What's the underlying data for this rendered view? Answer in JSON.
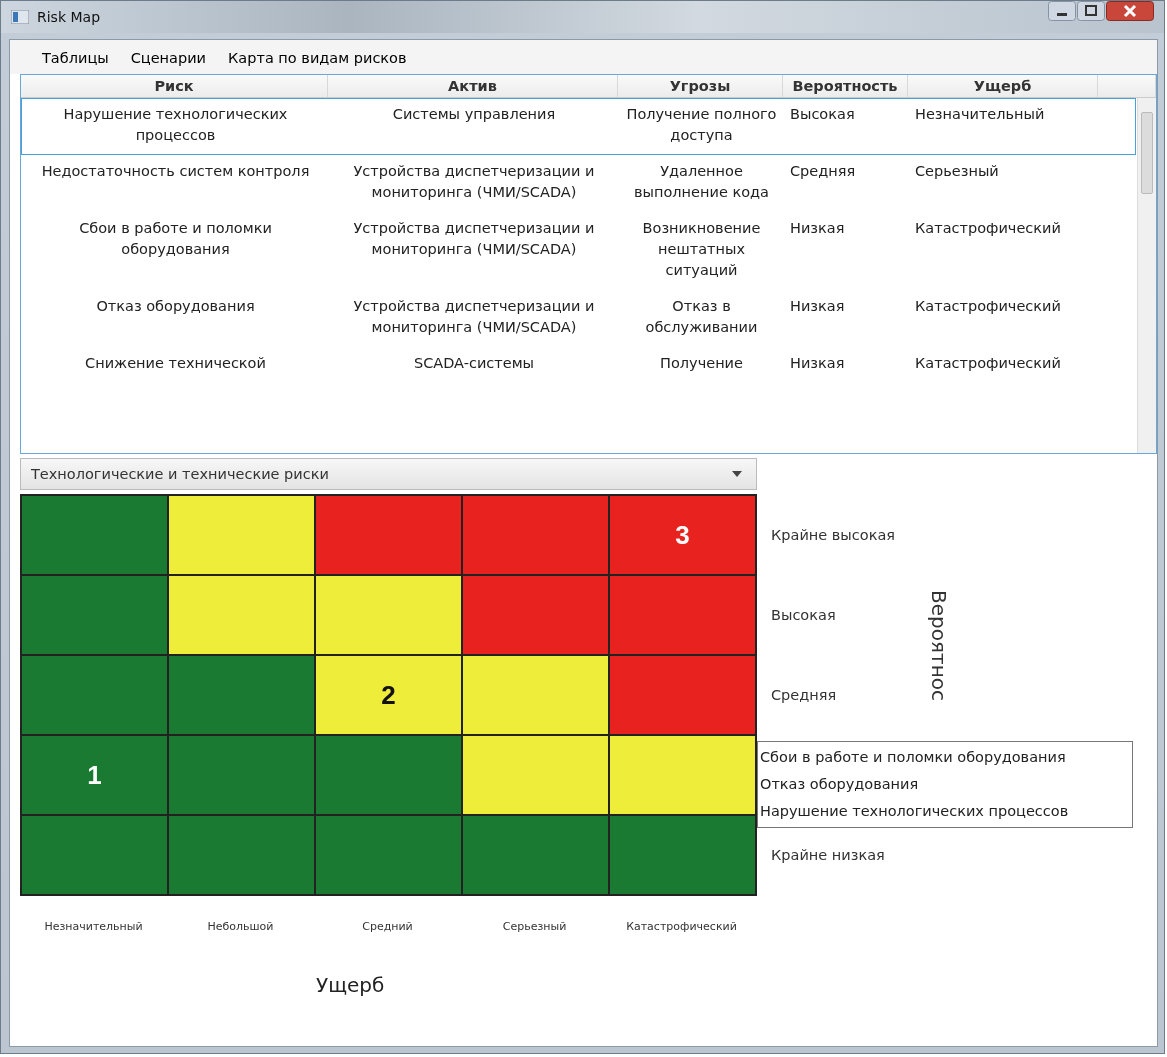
{
  "window": {
    "title": "Risk Map"
  },
  "menu": [
    {
      "label": "Таблицы"
    },
    {
      "label": "Сценарии"
    },
    {
      "label": "Карта по видам рисков"
    }
  ],
  "table": {
    "columns": [
      "Риск",
      "Актив",
      "Угрозы",
      "Вероятность",
      "Ущерб"
    ],
    "rows": [
      {
        "selected": true,
        "cells": [
          "Нарушение технологических процессов",
          "Системы управления",
          "Получение полного доступа",
          "Высокая",
          "Незначительный"
        ]
      },
      {
        "selected": false,
        "cells": [
          "Недостаточность систем контроля",
          "Устройства диспетчеризации и мониторинга (ЧМИ/SCADA)",
          "Удаленное выполнение кода",
          "Средняя",
          "Серьезный"
        ]
      },
      {
        "selected": false,
        "cells": [
          "Сбои в работе и поломки оборудования",
          "Устройства диспетчеризации и мониторинга (ЧМИ/SCADA)",
          "Возникновение нештатных ситуаций",
          "Низкая",
          "Катастрофический"
        ]
      },
      {
        "selected": false,
        "cells": [
          "Отказ оборудования",
          "Устройства диспетчеризации и мониторинга (ЧМИ/SCADA)",
          "Отказ в обслуживании",
          "Низкая",
          "Катастрофический"
        ]
      },
      {
        "selected": false,
        "cells": [
          "Снижение технической",
          "SCADA-системы",
          "Получение",
          "Низкая",
          "Катастрофический"
        ]
      }
    ]
  },
  "heatmap": {
    "category": "Технологические и технические риски",
    "rows": [
      {
        "label": "Крайне высокая",
        "cells": [
          {
            "color": "#1a7a32"
          },
          {
            "color": "#eded3a"
          },
          {
            "color": "#e8231f"
          },
          {
            "color": "#e8231f"
          },
          {
            "color": "#e8231f",
            "marker": "3"
          }
        ]
      },
      {
        "label": "Высокая",
        "cells": [
          {
            "color": "#1a7a32"
          },
          {
            "color": "#eded3a"
          },
          {
            "color": "#eded3a"
          },
          {
            "color": "#e8231f"
          },
          {
            "color": "#e8231f"
          }
        ]
      },
      {
        "label": "Средняя",
        "cells": [
          {
            "color": "#1a7a32"
          },
          {
            "color": "#1a7a32"
          },
          {
            "color": "#eded3a",
            "marker": "2"
          },
          {
            "color": "#eded3a"
          },
          {
            "color": "#e8231f"
          }
        ]
      },
      {
        "cells": [
          {
            "color": "#1a7a32",
            "marker": "1"
          },
          {
            "color": "#1a7a32"
          },
          {
            "color": "#1a7a32"
          },
          {
            "color": "#eded3a"
          },
          {
            "color": "#eded3a"
          }
        ]
      },
      {
        "label": "Крайне низкая",
        "cells": [
          {
            "color": "#1a7a32"
          },
          {
            "color": "#1a7a32"
          },
          {
            "color": "#1a7a32"
          },
          {
            "color": "#1a7a32"
          },
          {
            "color": "#1a7a32"
          }
        ]
      }
    ],
    "x_labels": [
      "Незначительный",
      "Небольшой",
      "Средний",
      "Серьезный",
      "Катастрофический"
    ],
    "x_title": "Ущерб",
    "y_title": "Вероятнос",
    "tooltip": [
      "Сбои в работе и поломки оборудования",
      "Отказ оборудования",
      "Нарушение технологических процессов"
    ]
  }
}
